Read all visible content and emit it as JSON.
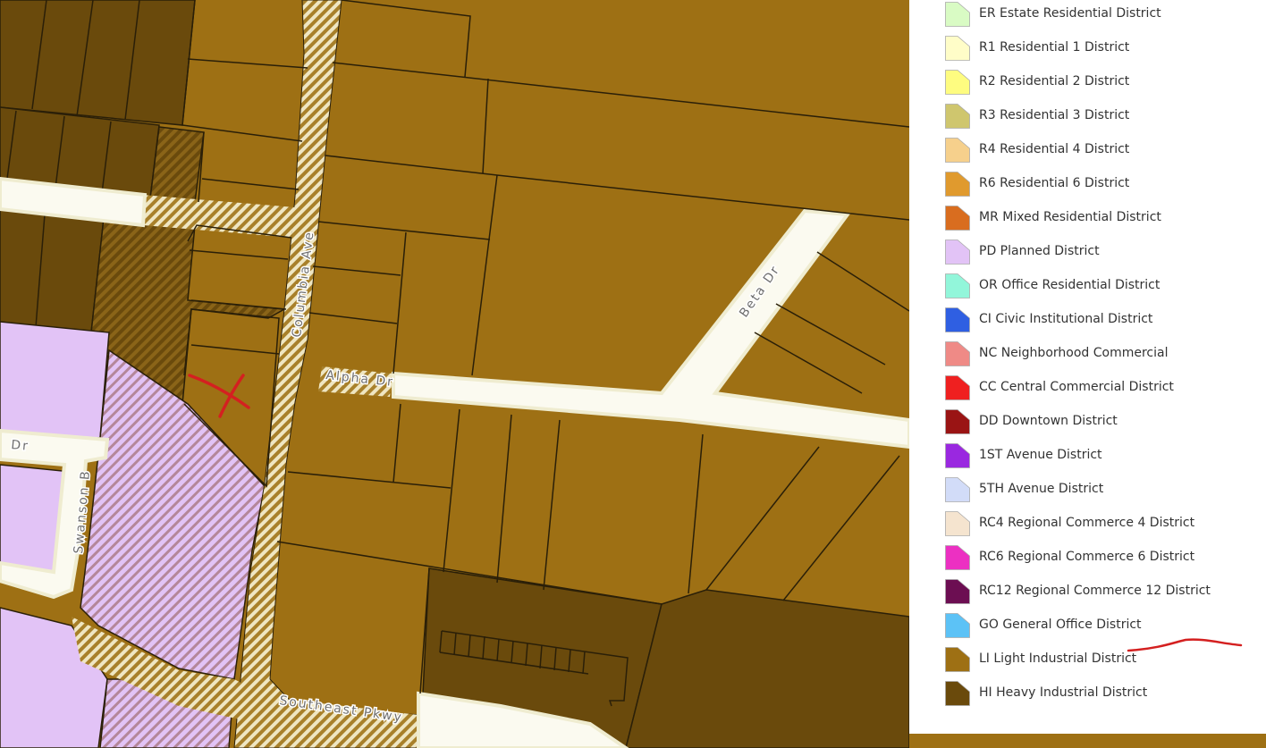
{
  "streets": {
    "columbia": "Columbia Ave",
    "alpha": "Alpha Dr",
    "beta": "Beta Dr",
    "swanson": "Swanson B",
    "dr_left": "Dr",
    "southeast": "Southeast Pkwy"
  },
  "legend": {
    "items": [
      {
        "label": "ER Estate Residential District",
        "color": "#d9fbc4"
      },
      {
        "label": "R1 Residential 1 District",
        "color": "#fffdc8"
      },
      {
        "label": "R2 Residential 2 District",
        "color": "#fefc80"
      },
      {
        "label": "R3 Residential 3 District",
        "color": "#cfc66e"
      },
      {
        "label": "R4 Residential 4 District",
        "color": "#f6d08c"
      },
      {
        "label": "R6 Residential 6 District",
        "color": "#e09a2e"
      },
      {
        "label": "MR Mixed Residential District",
        "color": "#d96d1f"
      },
      {
        "label": "PD Planned District",
        "color": "#e2c3f6"
      },
      {
        "label": "OR Office Residential District",
        "color": "#92f6da"
      },
      {
        "label": "CI Civic Institutional District",
        "color": "#2f5fe2"
      },
      {
        "label": "NC Neighborhood Commercial",
        "color": "#ef8a86"
      },
      {
        "label": "CC Central Commercial District",
        "color": "#ef2020"
      },
      {
        "label": "DD Downtown District",
        "color": "#9a1414"
      },
      {
        "label": "1ST Avenue District",
        "color": "#9a28e0"
      },
      {
        "label": "5TH Avenue District",
        "color": "#d2dcf8"
      },
      {
        "label": "RC4 Regional Commerce 4 District",
        "color": "#f5e4cf"
      },
      {
        "label": "RC6 Regional Commerce 6 District",
        "color": "#ec30c2"
      },
      {
        "label": "RC12 Regional Commerce 12 District",
        "color": "#6c0e52"
      },
      {
        "label": "GO General Office District",
        "color": "#5cc2f6"
      },
      {
        "label": "LI Light Industrial District",
        "color": "#9e7014"
      },
      {
        "label": "HI Heavy Industrial District",
        "color": "#6a4a0c"
      }
    ]
  },
  "colors": {
    "li": "#9e7014",
    "hi": "#6a4a0c",
    "pd": "#e2c3f6",
    "road": "#fbfaf0",
    "road_edge": "#efecd0",
    "annotation": "#d42020"
  }
}
